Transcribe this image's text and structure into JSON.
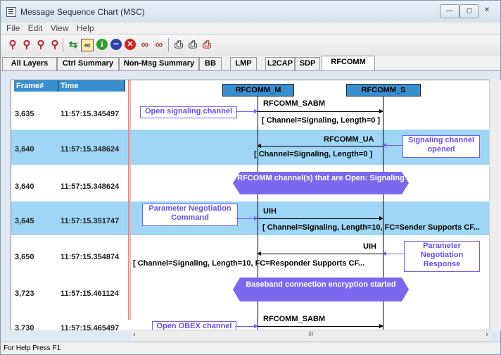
{
  "window": {
    "title": "Message Sequence Chart (MSC)",
    "min": "—",
    "max": "◻",
    "close": "✕"
  },
  "menu": [
    "File",
    "Edit",
    "View",
    "Help"
  ],
  "toolbar": {
    "icons": [
      "zoom-in-icon",
      "zoom-out-icon",
      "zoom-fit-icon",
      "zoom-reset-icon",
      "export-icon",
      "binoculars-icon",
      "info-icon",
      "minus-icon",
      "stop-icon",
      "find-prev-icon",
      "find-next-icon",
      "print-icon",
      "print-preview-icon",
      "print-close-icon"
    ],
    "colors": {
      "accent": "#3a8fd1",
      "note": "#7060f0",
      "hex": "#7b68ee",
      "highlight": "#9fd6f5"
    }
  },
  "tabs": [
    "All Layers",
    "Ctrl Summary",
    "Non-Msg Summary",
    "BB",
    "LMP",
    "L2CAP",
    "SDP",
    "RFCOMM"
  ],
  "table": {
    "headers": {
      "frame": "Frame#",
      "time": "Time"
    },
    "lifelines": [
      "RFCOMM_M",
      "RFCOMM_S"
    ],
    "rows": [
      {
        "frame": "3,635",
        "time": "11:57:15.345497"
      },
      {
        "frame": "3,640",
        "time": "11:57:15.348624"
      },
      {
        "frame": "3,640",
        "time": "11:57:15.348624"
      },
      {
        "frame": "3,645",
        "time": "11:57:15.351747"
      },
      {
        "frame": "3,650",
        "time": "11:57:15.354874"
      },
      {
        "frame": "3,723",
        "time": "11:57:15.461124"
      },
      {
        "frame": "3,730",
        "time": "11:57:15.465497"
      }
    ]
  },
  "messages": [
    {
      "label": "RFCOMM_SABM",
      "detail": "[ Channel=Signaling, Length=0 ]"
    },
    {
      "label": "RFCOMM_UA",
      "detail": "[ Channel=Signaling, Length=0 ]"
    },
    {
      "label": "UIH",
      "detail": "[ Channel=Signaling, Length=10, FC=Sender Supports CF..."
    },
    {
      "label": "UIH",
      "detail": "[ Channel=Signaling, Length=10, FC=Responder Supports CF..."
    },
    {
      "label": "RFCOMM_SABM",
      "detail": ""
    }
  ],
  "notes": {
    "open_signaling": "Open signaling channel",
    "signaling_opened": "Signaling channel opened",
    "param_neg_cmd": "Parameter Negotiation Command",
    "param_neg_resp": "Parameter Negotiation Response",
    "open_obex": "Open OBEX channel"
  },
  "hexes": {
    "open_channels": "RFCOMM channel(s) that are Open: Signaling",
    "encryption": "Baseband connection encryption started"
  },
  "scrollbar": {
    "left": "‹",
    "right": "›",
    "grip": "III"
  },
  "status": "For Help Press F1"
}
